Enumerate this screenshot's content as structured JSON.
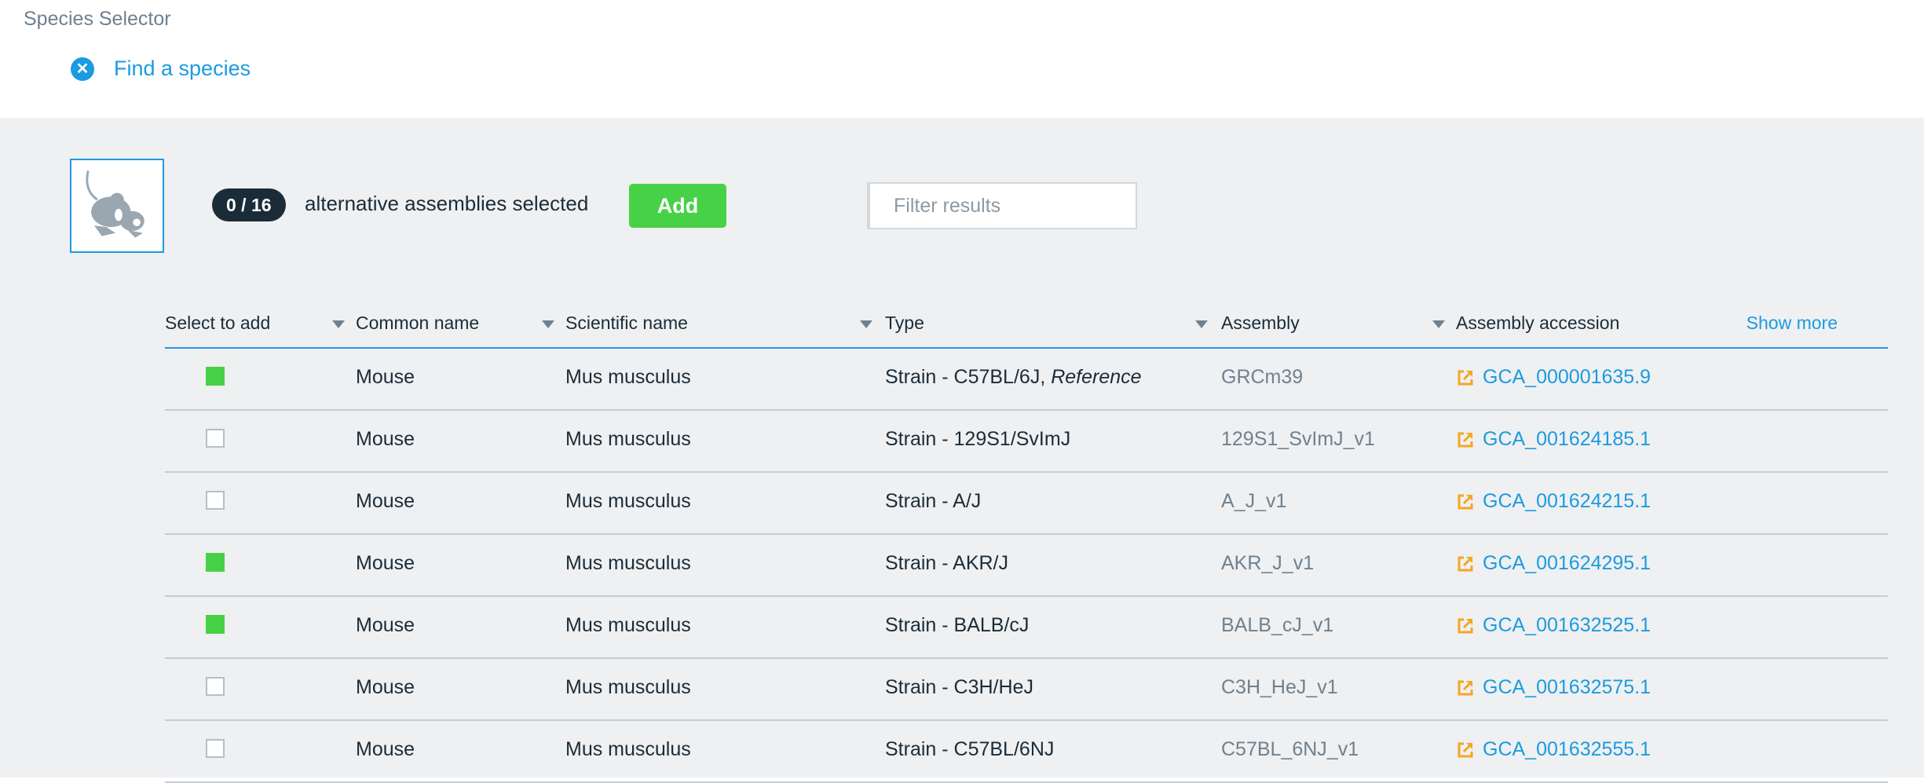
{
  "header": {
    "title": "Species Selector",
    "find_label": "Find a species",
    "close_icon": "close-icon"
  },
  "selection": {
    "count_badge": "0 / 16",
    "count_text": "alternative assemblies selected",
    "add_label": "Add",
    "filter_placeholder": "Filter results",
    "species_image": "mouse-silhouette"
  },
  "table": {
    "columns": [
      "Select to add",
      "Common name",
      "Scientific name",
      "Type",
      "Assembly",
      "Assembly accession"
    ],
    "show_more_label": "Show more",
    "rows": [
      {
        "checked": true,
        "common": "Mouse",
        "scientific": "Mus musculus",
        "type": "Strain - C57BL/6J, ",
        "type_tag": "Reference",
        "assembly": "GRCm39",
        "accession": "GCA_000001635.9"
      },
      {
        "checked": false,
        "common": "Mouse",
        "scientific": "Mus musculus",
        "type": "Strain - 129S1/SvImJ",
        "type_tag": "",
        "assembly": "129S1_SvImJ_v1",
        "accession": "GCA_001624185.1"
      },
      {
        "checked": false,
        "common": "Mouse",
        "scientific": "Mus musculus",
        "type": "Strain - A/J",
        "type_tag": "",
        "assembly": "A_J_v1",
        "accession": "GCA_001624215.1"
      },
      {
        "checked": true,
        "common": "Mouse",
        "scientific": "Mus musculus",
        "type": "Strain - AKR/J",
        "type_tag": "",
        "assembly": "AKR_J_v1",
        "accession": "GCA_001624295.1"
      },
      {
        "checked": true,
        "common": "Mouse",
        "scientific": "Mus musculus",
        "type": "Strain - BALB/cJ",
        "type_tag": "",
        "assembly": "BALB_cJ_v1",
        "accession": "GCA_001632525.1"
      },
      {
        "checked": false,
        "common": "Mouse",
        "scientific": "Mus musculus",
        "type": "Strain - C3H/HeJ",
        "type_tag": "",
        "assembly": "C3H_HeJ_v1",
        "accession": "GCA_001632575.1"
      },
      {
        "checked": false,
        "common": "Mouse",
        "scientific": "Mus musculus",
        "type": "Strain - C57BL/6NJ",
        "type_tag": "",
        "assembly": "C57BL_6NJ_v1",
        "accession": "GCA_001632555.1"
      }
    ]
  },
  "colors": {
    "accent": "#1b9be1",
    "add_green": "#47d147",
    "checked_green": "#47d147",
    "external_link_orange": "#f5a623",
    "badge_dark": "#1b2c39"
  }
}
